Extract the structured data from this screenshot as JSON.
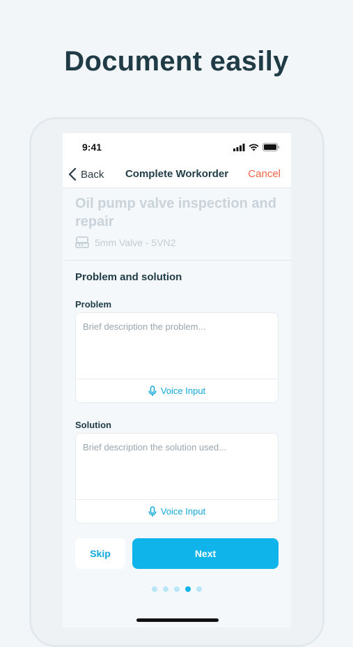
{
  "headline": "Document easily",
  "status_bar": {
    "time": "9:41"
  },
  "nav": {
    "back_label": "Back",
    "title": "Complete Workorder",
    "cancel_label": "Cancel"
  },
  "workorder": {
    "title": "Oil pump valve inspection and repair",
    "asset": "5mm Valve - 5VN2"
  },
  "section": {
    "title": "Problem and solution"
  },
  "problem": {
    "label": "Problem",
    "placeholder": "Brief description the problem...",
    "voice_label": "Voice Input"
  },
  "solution": {
    "label": "Solution",
    "placeholder": "Brief description the solution used...",
    "voice_label": "Voice Input"
  },
  "actions": {
    "skip_label": "Skip",
    "next_label": "Next"
  },
  "pagination": {
    "total": 5,
    "current": 4
  },
  "colors": {
    "accent": "#0eb4ea",
    "cancel": "#f0654a",
    "heading": "#1f3b45"
  }
}
